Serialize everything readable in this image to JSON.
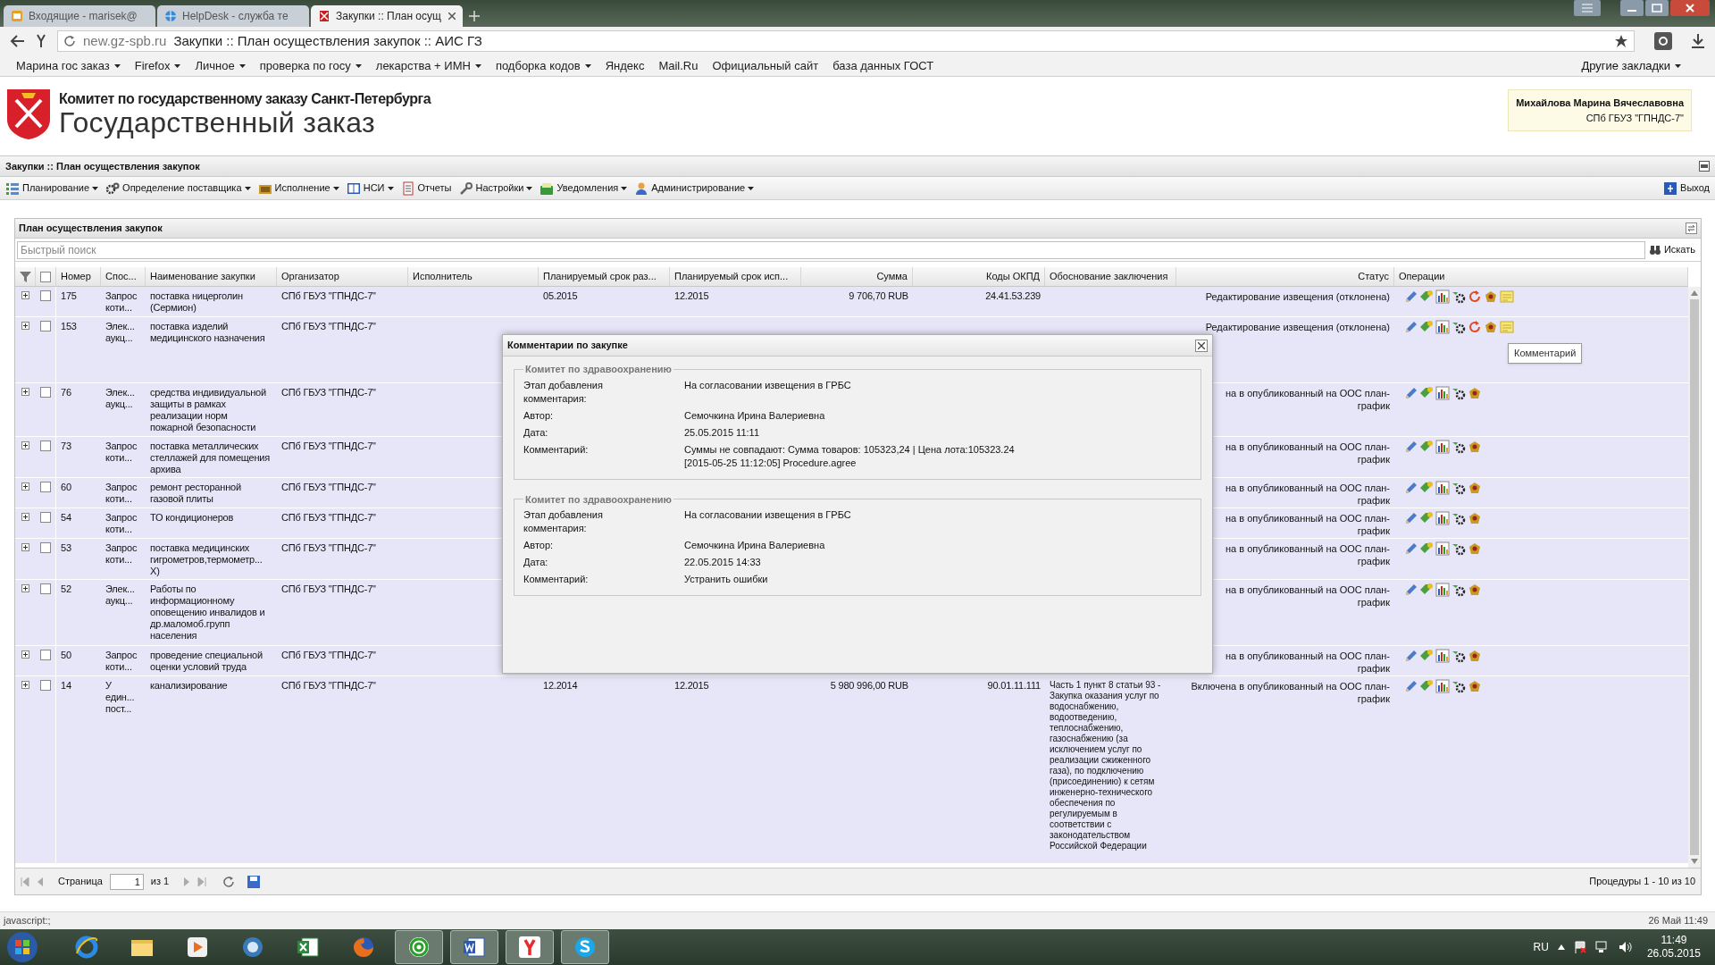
{
  "browser": {
    "tabs": [
      {
        "title": "Входящие - marisek@",
        "selected": false
      },
      {
        "title": "HelpDesk - служба те",
        "selected": false
      },
      {
        "title": "Закупки :: План осущ",
        "selected": true
      }
    ],
    "url_host": "new.gz-spb.ru",
    "url_title": "Закупки :: План осуществления закупок :: АИС ГЗ",
    "bookmarks": [
      {
        "label": "Марина гос заказ",
        "dropdown": true
      },
      {
        "label": "Firefox",
        "dropdown": true
      },
      {
        "label": "Личное",
        "dropdown": true
      },
      {
        "label": "проверка по госу",
        "dropdown": true
      },
      {
        "label": "лекарства + ИМН",
        "dropdown": true
      },
      {
        "label": "подборка кодов",
        "dropdown": true
      },
      {
        "label": "Яндекс",
        "dropdown": false
      },
      {
        "label": "Mail.Ru",
        "dropdown": false
      },
      {
        "label": "Официальный сайт",
        "dropdown": false
      },
      {
        "label": "база данных ГОСТ",
        "dropdown": false
      }
    ],
    "other_bookmarks": "Другие закладки"
  },
  "header": {
    "org": "Комитет по государственному заказу Санкт-Петербурга",
    "title": "Государственный заказ",
    "user_name": "Михайлова Марина Вячеславовна",
    "user_org": "СПб ГБУЗ \"ГПНДС-7\""
  },
  "page_title": "Закупки :: План осуществления закупок",
  "menu": [
    {
      "label": "Планирование",
      "dropdown": true
    },
    {
      "label": "Определение поставщика",
      "dropdown": true
    },
    {
      "label": "Исполнение",
      "dropdown": true
    },
    {
      "label": "НСИ",
      "dropdown": true
    },
    {
      "label": "Отчеты",
      "dropdown": false
    },
    {
      "label": "Настройки",
      "dropdown": true
    },
    {
      "label": "Уведомления",
      "dropdown": true
    },
    {
      "label": "Администрирование",
      "dropdown": true
    }
  ],
  "logout": "Выход",
  "panel": {
    "title": "План осуществления закупок",
    "search": {
      "placeholder": "Быстрый поиск"
    },
    "search_button": "Искать"
  },
  "table": {
    "select_all_checked": false,
    "columns": [
      "Номер",
      "Спос...",
      "Наименование закупки",
      "Организатор",
      "Исполнитель",
      "Планируемый срок раз...",
      "Планируемый срок исп...",
      "Сумма",
      "Коды ОКПД",
      "Обоснование заключения",
      "Статус",
      "Операции"
    ],
    "rows": [
      {
        "number": "175",
        "method": "Запрос коти...",
        "name": "поставка ницерголин (Сермион)",
        "organizer": "СПб ГБУЗ \"ГПНДС-7\"",
        "placed": "05.2015",
        "executed": "12.2015",
        "sum": "9 706,70 RUB",
        "okpd": "24.41.53.239",
        "status": "Редактирование извещения (отклонена)",
        "rework_actions": true,
        "checked": false
      },
      {
        "number": "153",
        "method": "Элек... аукц...",
        "name": "поставка изделий медицинского назначения",
        "organizer": "СПб ГБУЗ \"ГПНДС-7\"",
        "status": "Редактирование извещения (отклонена)",
        "rework_actions": true,
        "checked": false
      },
      {
        "number": "76",
        "method": "Элек... аукц...",
        "name": "средства индивидуальной защиты в рамках реализации норм пожарной безопасности",
        "organizer": "СПб ГБУЗ \"ГПНДС-7\"",
        "status": "на в опубликованный на ООС план-\nграфик",
        "rework_actions": false,
        "checked": false
      },
      {
        "number": "73",
        "method": "Запрос коти...",
        "name": "поставка металлических стеллажей для помещения архива",
        "organizer": "СПб ГБУЗ \"ГПНДС-7\"",
        "status": "на в опубликованный на ООС план-\nграфик",
        "rework_actions": false,
        "checked": false
      },
      {
        "number": "60",
        "method": "Запрос коти...",
        "name": "ремонт ресторанной газовой плиты",
        "organizer": "СПб ГБУЗ \"ГПНДС-7\"",
        "status": "на в опубликованный на ООС план-\nграфик",
        "rework_actions": false,
        "checked": false
      },
      {
        "number": "54",
        "method": "Запрос коти...",
        "name": "ТО кондиционеров",
        "organizer": "СПб ГБУЗ \"ГПНДС-7\"",
        "status": "на в опубликованный на ООС план-\nграфик",
        "rework_actions": false,
        "checked": false
      },
      {
        "number": "53",
        "method": "Запрос коти...",
        "name": "поставка медицинских гигрометров,термометр... Х)",
        "organizer": "СПб ГБУЗ \"ГПНДС-7\"",
        "status": "на в опубликованный на ООС план-\nграфик",
        "rework_actions": false,
        "checked": false
      },
      {
        "number": "52",
        "method": "Элек... аукц...",
        "name": "Работы по информационному оповещению инвалидов и др.маломоб.групп населения",
        "organizer": "СПб ГБУЗ \"ГПНДС-7\"",
        "status": "на в опубликованный на ООС план-\nграфик",
        "rework_actions": false,
        "checked": false
      },
      {
        "number": "50",
        "method": "Запрос коти...",
        "name": "проведение специальной оценки условий труда",
        "organizer": "СПб ГБУЗ \"ГПНДС-7\"",
        "status": "на в опубликованный на ООС план-\nграфик",
        "rework_actions": false,
        "checked": false
      },
      {
        "number": "14",
        "method": "У един... пост...",
        "name": "канализирование",
        "organizer": "СПб ГБУЗ \"ГПНДС-7\"",
        "placed": "12.2014",
        "executed": "12.2015",
        "sum": "5 980 996,00 RUB",
        "okpd": "90.01.11.111",
        "reason": "Часть 1 пункт 8 статьи 93 - Закупка оказания услуг по водоснабжению, водоотведению, теплоснабжению, газоснабжению (за исключением услуг по реализации сжиженного газа), по подключению (присоединению) к сетям инженерно-технического обеспечения по регулируемым в соответствии с законодательством Российской Федерации",
        "status": "Включена в опубликованный на ООС план-\nграфик",
        "rework_actions": false,
        "checked": false
      }
    ]
  },
  "tooltip": "Комментарий",
  "dialog": {
    "title": "Комментарии по закупке",
    "comments": [
      {
        "group": "Комитет по здравоохранению",
        "fields": [
          {
            "label": "Этап добавления комментария:",
            "value": "На согласовании извещения в ГРБС"
          },
          {
            "label": "Автор:",
            "value": "Семочкина Ирина Валериевна"
          },
          {
            "label": "Дата:",
            "value": "25.05.2015 11:11"
          },
          {
            "label": "Комментарий:",
            "value": "Суммы не совпадают: Сумма товаров: 105323,24 | Цена лота:105323.24\n[2015-05-25 11:12:05] Procedure.agree"
          }
        ]
      },
      {
        "group": "Комитет по здравоохранению",
        "fields": [
          {
            "label": "Этап добавления комментария:",
            "value": "На согласовании извещения в ГРБС"
          },
          {
            "label": "Автор:",
            "value": "Семочкина Ирина Валериевна"
          },
          {
            "label": "Дата:",
            "value": "22.05.2015 14:33"
          },
          {
            "label": "Комментарий:",
            "value": "Устранить ошибки"
          }
        ]
      }
    ]
  },
  "pager": {
    "page_label": "Страница",
    "page": "1",
    "of": "из 1",
    "summary": "Процедуры 1 - 10 из 10"
  },
  "status_bar": {
    "text": "javascript:;",
    "right": "26 Май 11:49"
  },
  "taskbar": {
    "apps": [
      {
        "kind": "ie",
        "running": false
      },
      {
        "kind": "folder",
        "running": false
      },
      {
        "kind": "media",
        "running": false
      },
      {
        "kind": "app",
        "running": false
      },
      {
        "kind": "excel",
        "running": false
      },
      {
        "kind": "firefox",
        "running": false
      },
      {
        "kind": "mail",
        "running": true
      },
      {
        "kind": "word",
        "running": true
      },
      {
        "kind": "yandex",
        "running": true
      },
      {
        "kind": "skype",
        "running": true
      }
    ],
    "lang": "RU",
    "time": "11:49",
    "date": "26.05.2015"
  }
}
